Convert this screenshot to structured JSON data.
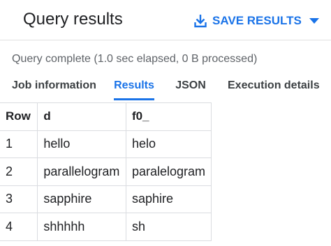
{
  "header": {
    "title": "Query results",
    "save_label": "SAVE RESULTS"
  },
  "status": "Query complete (1.0 sec elapsed, 0 B processed)",
  "tabs": [
    {
      "label": "Job information",
      "active": false
    },
    {
      "label": "Results",
      "active": true
    },
    {
      "label": "JSON",
      "active": false
    },
    {
      "label": "Execution details",
      "active": false
    }
  ],
  "table": {
    "headers": [
      "Row",
      "d",
      "f0_"
    ],
    "rows": [
      [
        "1",
        "hello",
        "helo"
      ],
      [
        "2",
        "parallelogram",
        "paralelogram"
      ],
      [
        "3",
        "sapphire",
        "saphire"
      ],
      [
        "4",
        "shhhhh",
        "sh"
      ]
    ]
  },
  "colors": {
    "accent": "#1a73e8",
    "text": "#202124",
    "muted": "#5f6368",
    "border": "#dadce0"
  },
  "icons": {
    "save": "download-icon",
    "dropdown": "caret-down-icon"
  }
}
